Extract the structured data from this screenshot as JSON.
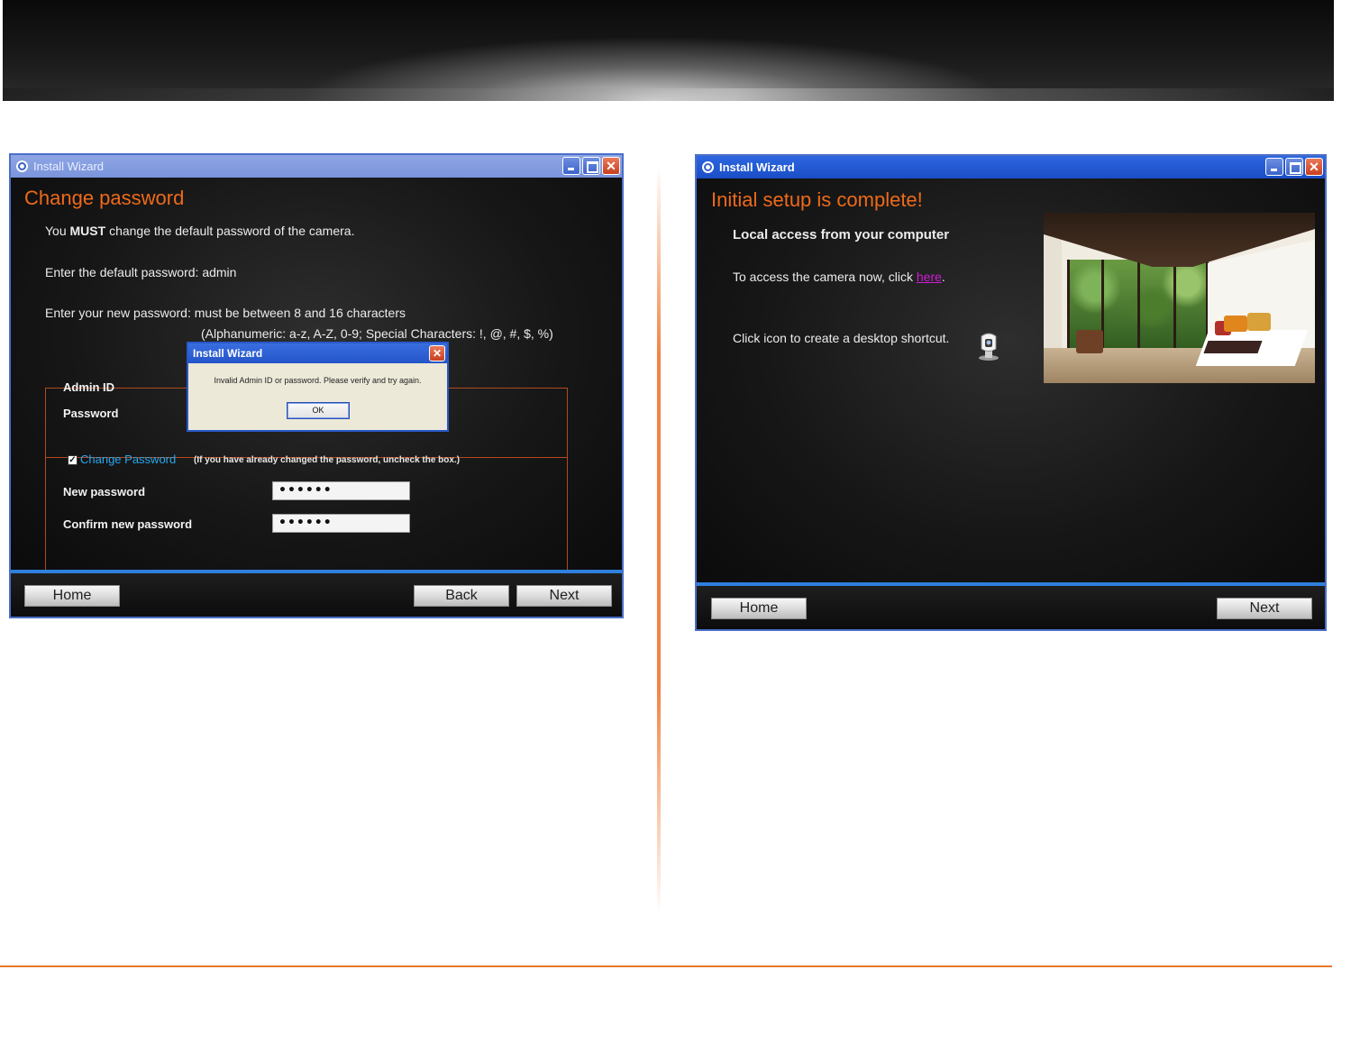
{
  "left_window": {
    "title": "Install Wizard",
    "heading": "Change password",
    "must_prefix": "You ",
    "must_bold": "MUST",
    "must_suffix": " change the default password of the camera.",
    "default_pw_text": "Enter the default password: admin",
    "new_pw_text": "Enter your new password: must be between 8 and 16 characters",
    "charset_text": "(Alphanumeric: a-z, A-Z, 0-9; Special Characters: !, @, #, $, %)",
    "admin_id_label": "Admin ID",
    "password_label": "Password",
    "change_password_checked": true,
    "change_password_label": "Change Password",
    "change_password_note": "(If you have already changed the password, uncheck the box.)",
    "new_password_label": "New password",
    "new_password_value": "••••••",
    "confirm_password_label": "Confirm new password",
    "confirm_password_value": "••••••",
    "buttons": {
      "home": "Home",
      "back": "Back",
      "next": "Next"
    },
    "dialog": {
      "title": "Install Wizard",
      "message": "Invalid Admin ID or password. Please verify and try again.",
      "ok": "OK"
    }
  },
  "right_window": {
    "title": "Install Wizard",
    "heading": "Initial setup is complete!",
    "subheading": "Local access from your computer",
    "access_text": "To access the camera now, click ",
    "access_link": "here",
    "access_after": ".",
    "shortcut_text": "Click icon to create a desktop shortcut.",
    "shortcut_icon": "camera-shortcut-icon",
    "photo": "bedroom-room-photo",
    "buttons": {
      "home": "Home",
      "next": "Next"
    }
  },
  "colors": {
    "heading_orange": "#ee6a1a",
    "accent_blue": "#2f7fdc",
    "link_magenta": "#d11ad6",
    "rule_orange": "#e9772b"
  }
}
